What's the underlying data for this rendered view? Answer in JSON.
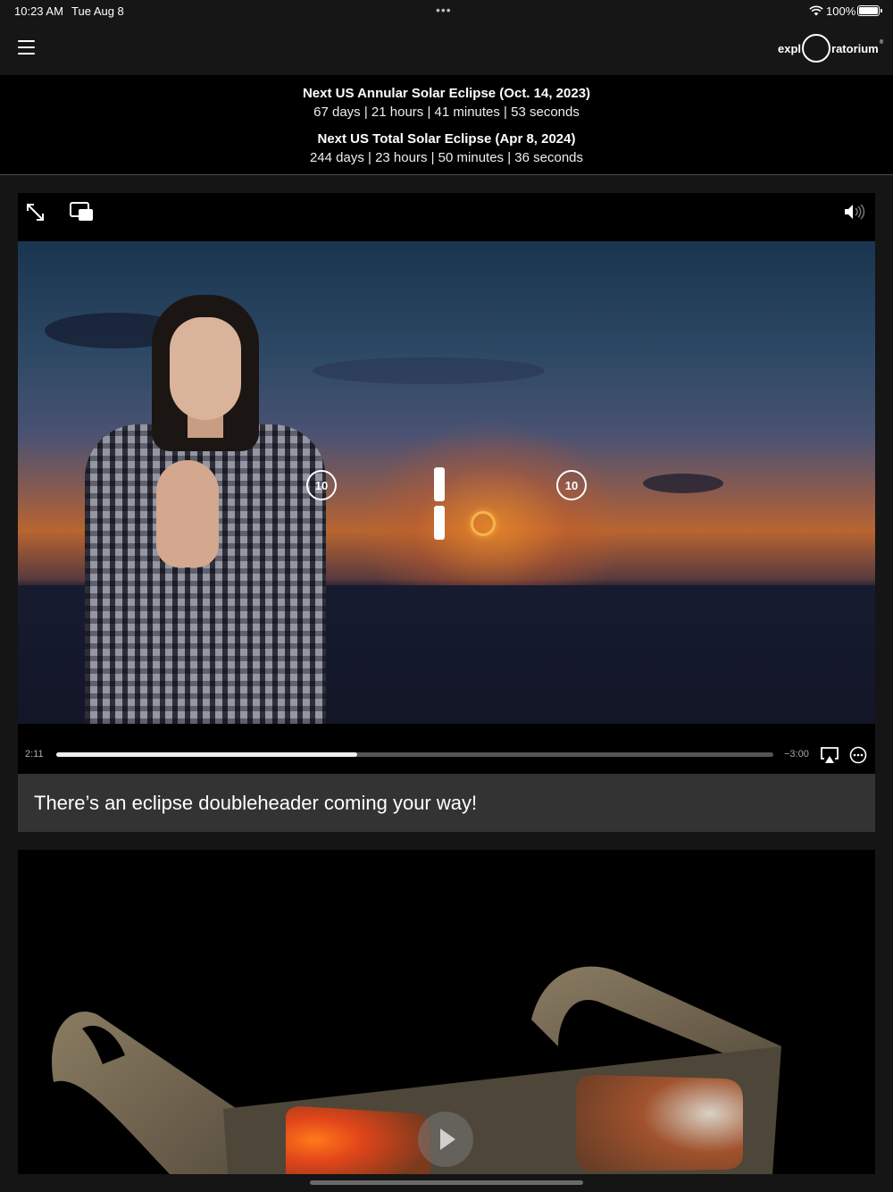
{
  "status_bar": {
    "time": "10:23 AM",
    "date": "Tue Aug 8",
    "multitask_dots": "•••",
    "battery_percent": "100%",
    "icons": [
      "wifi-icon",
      "battery-icon"
    ]
  },
  "header": {
    "menu_icon": "hamburger-menu-icon",
    "logo": {
      "left": "expl",
      "right": "ratorium",
      "mark": "®"
    }
  },
  "countdowns": [
    {
      "title": "Next US Annular Solar Eclipse (Oct. 14, 2023)",
      "remaining": "67 days | 21 hours | 41 minutes | 53 seconds"
    },
    {
      "title": "Next US Total Solar Eclipse (Apr 8, 2024)",
      "remaining": "244 days | 23 hours | 50 minutes | 36 seconds"
    }
  ],
  "player": {
    "top_controls": [
      "fullscreen-icon",
      "picture-in-picture-icon",
      "volume-icon"
    ],
    "skip_back": "10",
    "skip_forward": "10",
    "state": "playing",
    "elapsed": "2:11",
    "remaining": "−3:00",
    "progress_fraction": 0.42,
    "bottom_controls": [
      "airplay-icon",
      "more-options-icon"
    ]
  },
  "caption": {
    "text": "There’s an eclipse doubleheader coming your way!"
  },
  "second_video": {
    "state": "paused",
    "controls": [
      "play-icon"
    ]
  },
  "colors": {
    "background": "#151515",
    "banner": "#000000",
    "caption_bg": "#333333",
    "progress_fill": "#eeeeee",
    "progress_track": "#555555"
  }
}
